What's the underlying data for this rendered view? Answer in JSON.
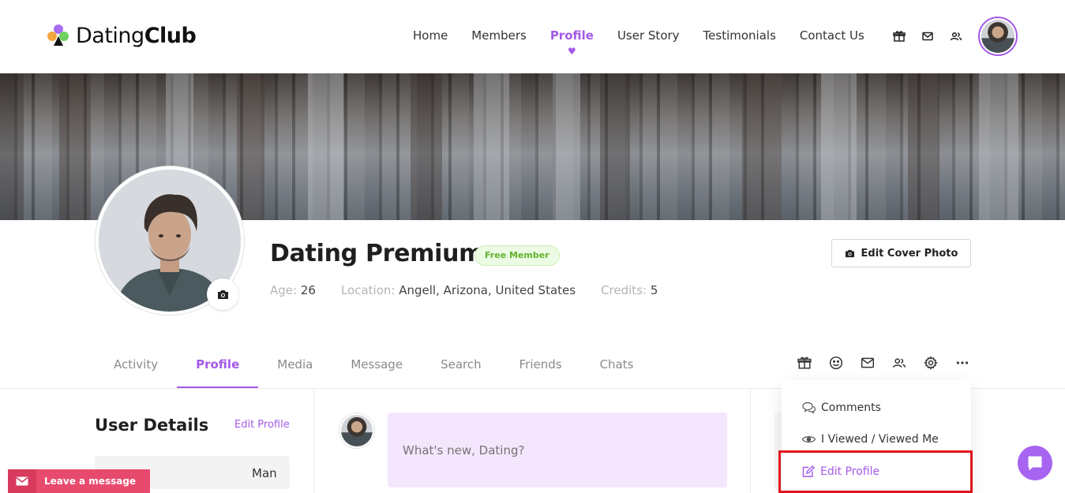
{
  "header": {
    "logo_light": "Dating",
    "logo_bold": "Club",
    "nav": [
      {
        "label": "Home",
        "active": false
      },
      {
        "label": "Members",
        "active": false
      },
      {
        "label": "Profile",
        "active": true
      },
      {
        "label": "User Story",
        "active": false
      },
      {
        "label": "Testimonials",
        "active": false
      },
      {
        "label": "Contact Us",
        "active": false
      }
    ],
    "icons": [
      "gift-icon",
      "mail-icon",
      "friends-icon"
    ]
  },
  "profile": {
    "name": "Dating Premium",
    "badge": "Free Member",
    "age_label": "Age:",
    "age": "26",
    "location_label": "Location:",
    "location": "Angell, Arizona, United States",
    "credits_label": "Credits:",
    "credits": "5",
    "edit_cover_label": "Edit Cover Photo"
  },
  "tabs": [
    {
      "label": "Activity",
      "active": false
    },
    {
      "label": "Profile",
      "active": true
    },
    {
      "label": "Media",
      "active": false
    },
    {
      "label": "Message",
      "active": false
    },
    {
      "label": "Search",
      "active": false
    },
    {
      "label": "Friends",
      "active": false
    },
    {
      "label": "Chats",
      "active": false
    }
  ],
  "action_icons": [
    "gift-icon",
    "smiley-icon",
    "mail-icon",
    "friends-icon",
    "gear-icon",
    "more-icon"
  ],
  "user_details": {
    "title": "User Details",
    "edit_label": "Edit Profile",
    "first_value": "Man"
  },
  "post": {
    "placeholder": "What's new, Dating?"
  },
  "dropdown": {
    "items": [
      {
        "label": "Comments",
        "icon": "comments-icon"
      },
      {
        "label": "I Viewed / Viewed Me",
        "icon": "eye-icon"
      },
      {
        "label": "Edit Profile",
        "icon": "edit-icon",
        "active": true
      }
    ]
  },
  "leave_message": "Leave a message",
  "colors": {
    "accent": "#a35ae8",
    "badge_green": "#63b22e",
    "leave_message_bg": "#e84a6d",
    "highlight_red": "#e0141e"
  }
}
